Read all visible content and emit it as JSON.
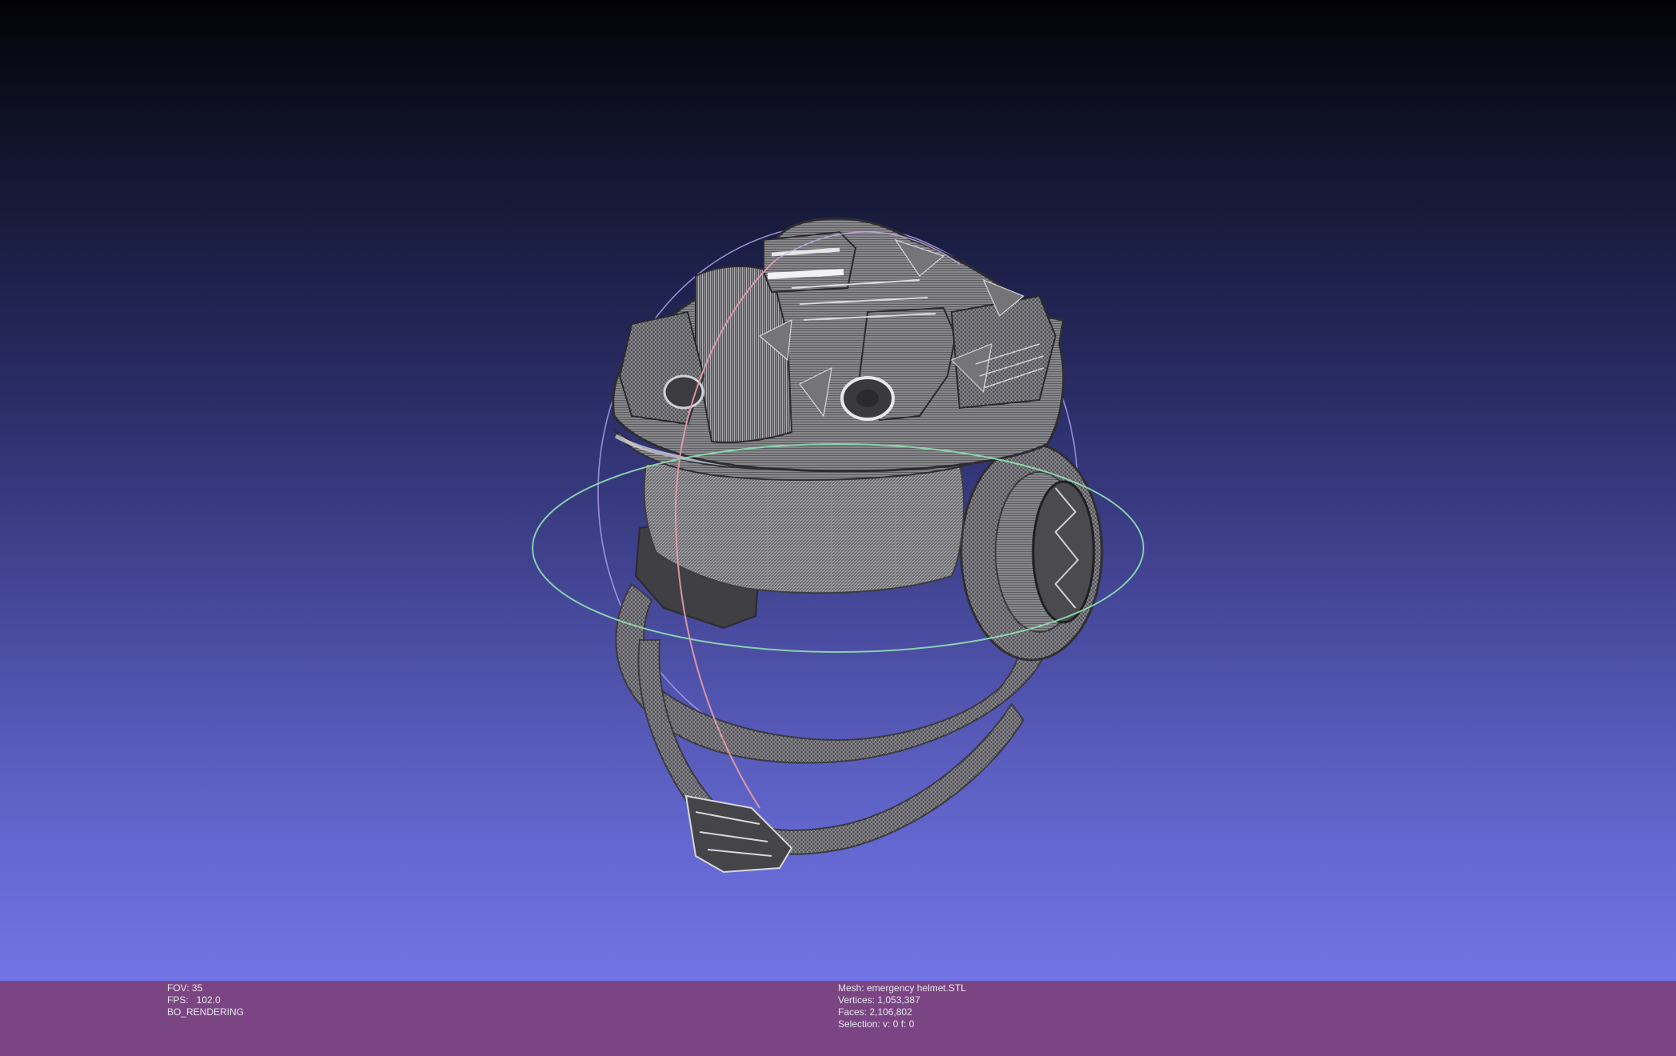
{
  "viewport": {
    "model": "3d-helmet-wireframe-mesh",
    "background_gradient": [
      "#030306",
      "#141733",
      "#2a2c66",
      "#46489a",
      "#5f63c8",
      "#7274e6"
    ],
    "trackball_colors": {
      "horizontal": "#8fe0b0",
      "vertical_pink": "#e29aa8",
      "vertical_blue": "#a8a0e8"
    }
  },
  "info_left": {
    "fov": "FOV: 35",
    "fps": "FPS:   102.0",
    "mode": "BO_RENDERING"
  },
  "info_right": {
    "mesh": "Mesh: emergency helmet.STL",
    "vertices": "Vertices: 1,053,387",
    "faces": "Faces: 2,106,802",
    "selection": "Selection: v: 0 f: 0"
  },
  "colors": {
    "info_bar_bg": "#7b4584",
    "info_text": "#e6e6ee",
    "mesh_fill": "#5a5a5e",
    "mesh_line": "#cfcfd4"
  }
}
